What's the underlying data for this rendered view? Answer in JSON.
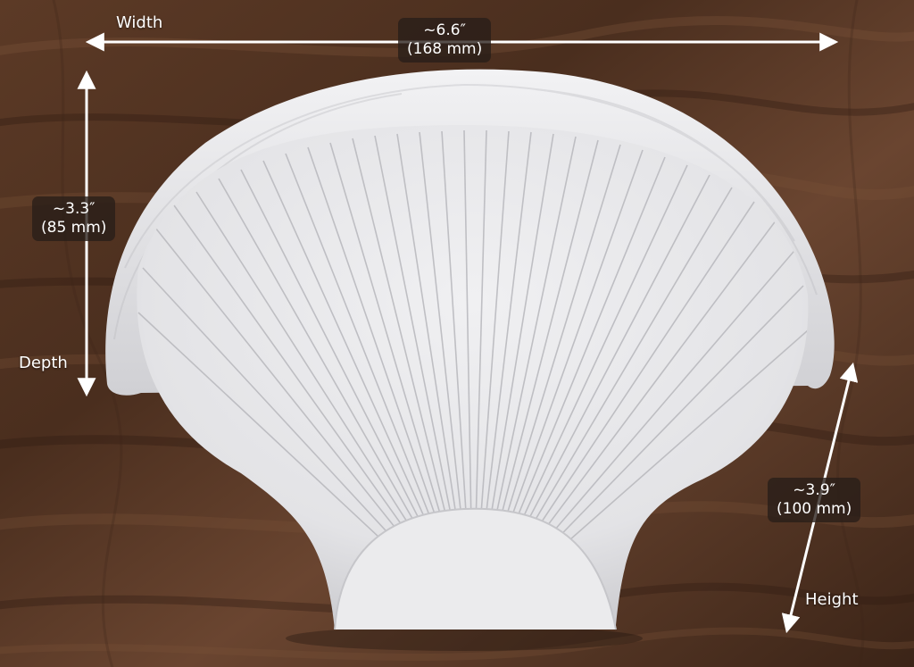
{
  "colors": {
    "wood_base": "#4a2e1e",
    "wood_light": "#7a5238",
    "wood_dark": "#2e1a10",
    "shell": "#e6e6e8",
    "shell_shadow": "#c9c9cc",
    "arrow": "#ffffff",
    "badge_bg": "rgba(40,30,24,0.78)"
  },
  "dimensions": {
    "width": {
      "axis_label": "Width",
      "imperial": "~6.6″",
      "metric": "(168 mm)"
    },
    "depth": {
      "axis_label": "Depth",
      "imperial": "~3.3″",
      "metric": "(85 mm)"
    },
    "height": {
      "axis_label": "Height",
      "imperial": "~3.9″",
      "metric": "(100 mm)"
    }
  },
  "icons": {
    "shell": "scallop-shell-icon",
    "arrow": "double-headed-arrow-icon"
  }
}
